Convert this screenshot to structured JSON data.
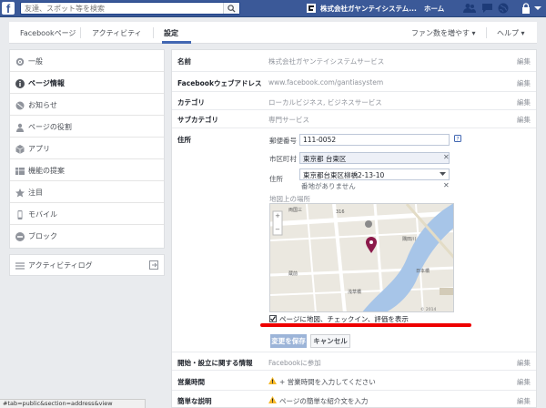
{
  "topbar": {
    "logo": "f",
    "search_placeholder": "友達、スポット等を検索",
    "page_name": "株式会社ガヤンテイシステム...",
    "home": "ホーム"
  },
  "nav": {
    "tabs": [
      "Facebookページ",
      "アクティビティ",
      "設定"
    ],
    "fan_button": "ファン数を増やす ▾",
    "help": "ヘルプ ▾"
  },
  "sidebar": {
    "items": [
      {
        "label": "一般",
        "icon": "gear-icon"
      },
      {
        "label": "ページ情報",
        "icon": "info-icon"
      },
      {
        "label": "お知らせ",
        "icon": "globe-icon"
      },
      {
        "label": "ページの役割",
        "icon": "person-icon"
      },
      {
        "label": "アプリ",
        "icon": "cube-icon"
      },
      {
        "label": "機能の提案",
        "icon": "grid-icon"
      },
      {
        "label": "注目",
        "icon": "star-icon"
      },
      {
        "label": "モバイル",
        "icon": "phone-icon"
      },
      {
        "label": "ブロック",
        "icon": "block-icon"
      }
    ],
    "activity_log": "アクティビティログ"
  },
  "info": {
    "name_label": "名前",
    "name_value": "株式会社ガヤンテイシステムサービス",
    "url_label": "Facebookウェブアドレス",
    "url_value": "www.facebook.com/gantiasystem",
    "category_label": "カテゴリ",
    "category_value": "ローカルビジネス, ビジネスサービス",
    "subcategory_label": "サブカテゴリ",
    "subcategory_value": "専門サービス",
    "edit": "編集"
  },
  "address": {
    "label": "住所",
    "postal_label": "郵便番号",
    "postal_value": "111-0052",
    "city_label": "市区町村",
    "city_value": "東京都 台東区",
    "street_label": "住所",
    "street_value": "東京都台東区柳橋2-13-10",
    "street_note": "番地がありません",
    "map_label": "地図上の場所",
    "checkbox_label": "ページに地図、チェックイン、評価を表示",
    "save": "変更を保存",
    "cancel": "キャンセル"
  },
  "more": {
    "founded_label": "開始・設立に関する情報",
    "founded_value": "Facebookに参加",
    "hours_label": "営業時間",
    "hours_value": "+ 営業時間を入力してください",
    "desc_label": "簡単な説明",
    "desc_value": "ページの簡単な紹介文を入力"
  },
  "map_labels": {
    "label_1": "両国三",
    "label_2": "316",
    "label_3": "蔵前",
    "label_4": "浅草橋",
    "label_5": "日本橋",
    "label_6": "隅田川",
    "copyright": "© 2014"
  },
  "statusbar": "#tab=public&section=address&view",
  "colors": {
    "brand": "#3b5998",
    "annotation": "#e00000"
  }
}
